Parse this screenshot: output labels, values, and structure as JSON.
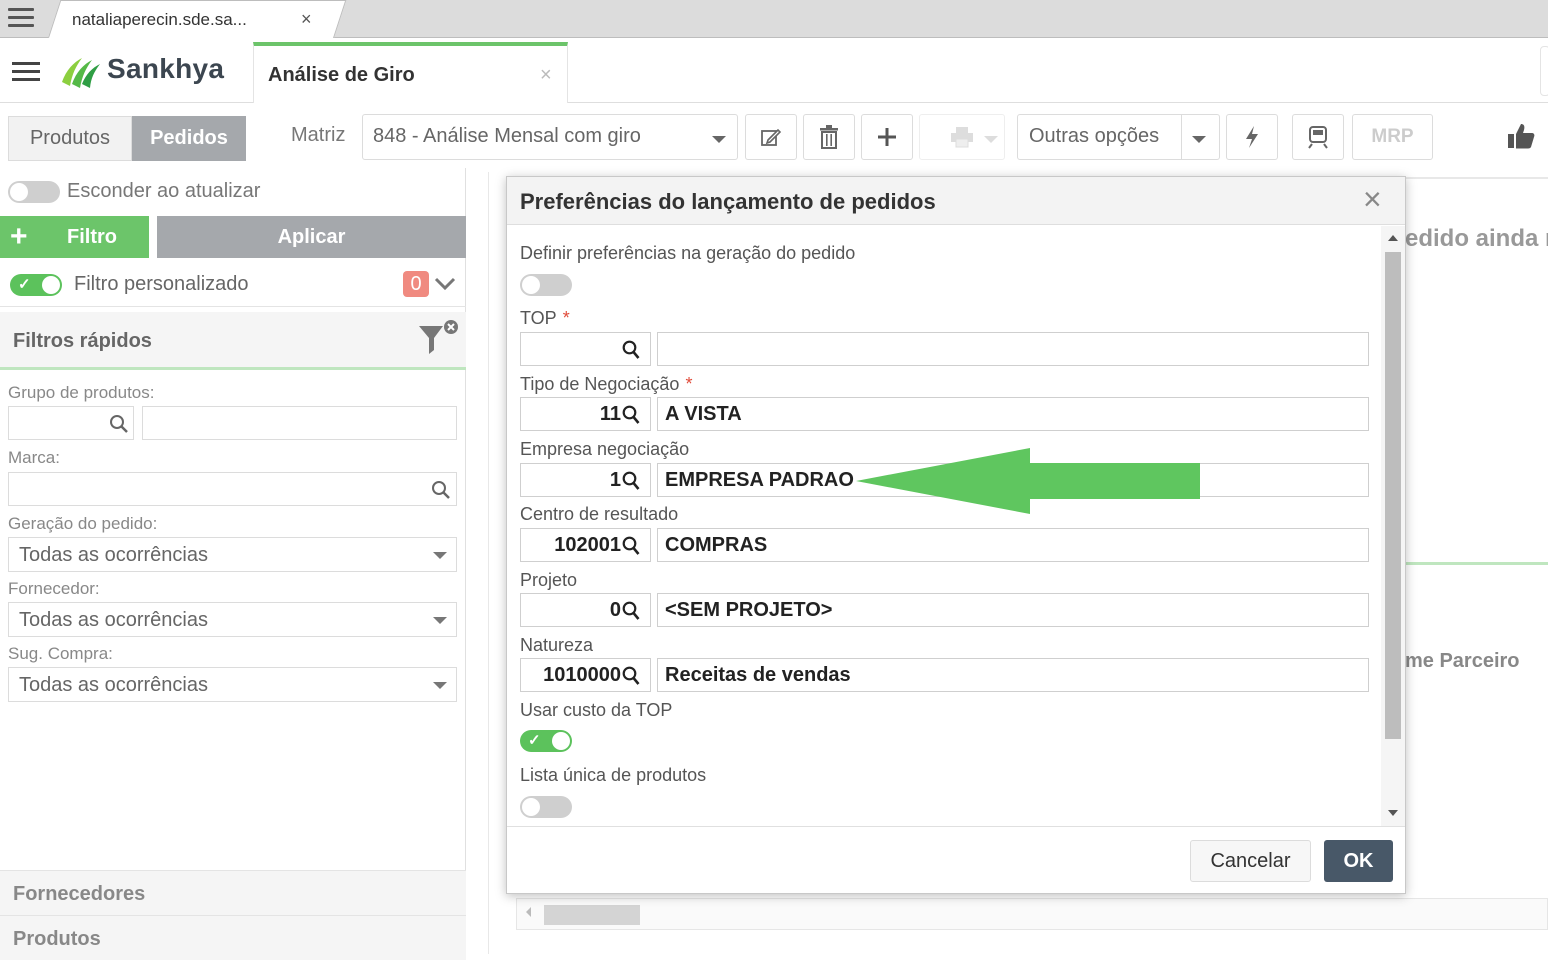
{
  "browser": {
    "tab_title": "nataliaperecin.sde.sa...",
    "tab_close": "×"
  },
  "app": {
    "logo_text": "Sankhya",
    "tab_title": "Análise de Giro",
    "tab_close": "×",
    "brand_color": "#6cc46a"
  },
  "toolbar": {
    "segments": [
      "Produtos",
      "Pedidos"
    ],
    "active_segment": "Pedidos",
    "matriz_label": "Matriz",
    "matriz_value": "848 - Análise Mensal com giro",
    "outras_label": "Outras opções",
    "mrp_label": "MRP",
    "icons": [
      "edit-icon",
      "trash-icon",
      "plus-icon",
      "print-icon",
      "lightning-icon",
      "train-icon",
      "thumbs-up-icon"
    ]
  },
  "left": {
    "esconder_label": "Esconder ao atualizar",
    "esconder_on": false,
    "filtro_label": "Filtro",
    "aplicar_label": "Aplicar",
    "filtro_pers_label": "Filtro personalizado",
    "filtro_pers_on": true,
    "filtro_count": "0",
    "rapidos_label": "Filtros rápidos",
    "grupo_label": "Grupo de produtos:",
    "marca_label": "Marca:",
    "geracao_label": "Geração do pedido:",
    "geracao_value": "Todas as ocorrências",
    "fornecedor_label": "Fornecedor:",
    "fornecedor_value": "Todas as ocorrências",
    "sug_label": "Sug. Compra:",
    "sug_value": "Todas as ocorrências",
    "fornecedores_section": "Fornecedores",
    "produtos_section": "Produtos"
  },
  "background": {
    "message_fragment": "edido ainda n",
    "column_fragment": "me Parceiro"
  },
  "dialog": {
    "title": "Preferências do lançamento de pedidos",
    "close": "×",
    "definir_label": "Definir preferências na geração do pedido",
    "definir_on": false,
    "top_label": "TOP",
    "required_mark": "*",
    "top_code": "",
    "top_desc": "",
    "tipo_label": "Tipo de Negociação",
    "tipo_code": "11",
    "tipo_desc": "A VISTA",
    "empresa_label": "Empresa negociação",
    "empresa_code": "1",
    "empresa_desc": "EMPRESA PADRAO",
    "centro_label": "Centro de resultado",
    "centro_code": "102001",
    "centro_desc": "COMPRAS",
    "projeto_label": "Projeto",
    "projeto_code": "0",
    "projeto_desc": "<SEM PROJETO>",
    "natureza_label": "Natureza",
    "natureza_code": "1010000",
    "natureza_desc": "Receitas de vendas",
    "usar_custo_label": "Usar custo da TOP",
    "usar_custo_on": true,
    "lista_label": "Lista única de produtos",
    "lista_on": false,
    "cancel_label": "Cancelar",
    "ok_label": "OK",
    "ok_color": "#485868",
    "annotation_arrow_color": "#5fc65f"
  }
}
